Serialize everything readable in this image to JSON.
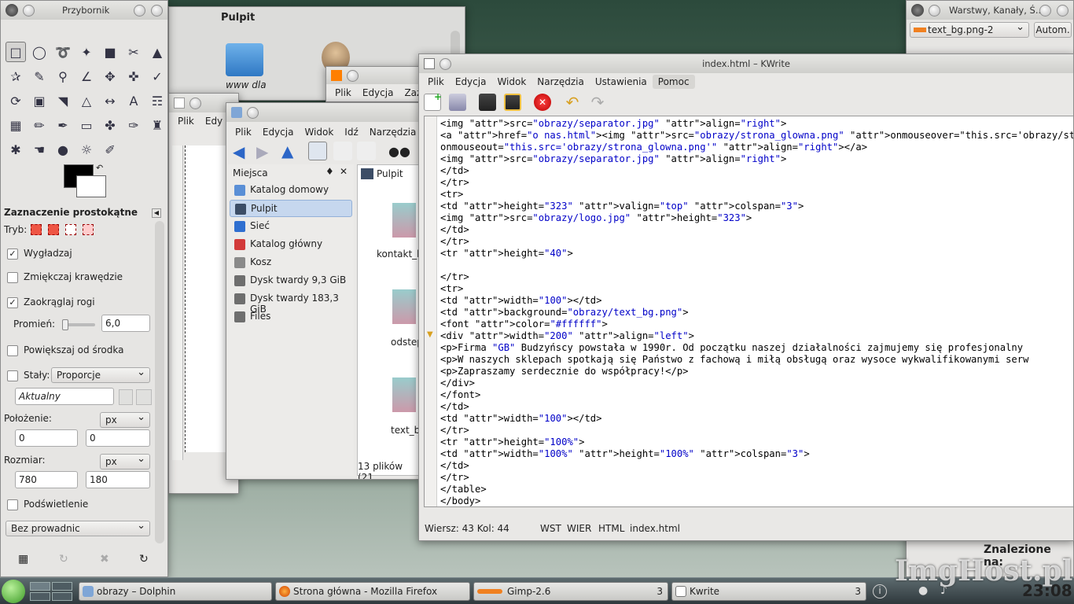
{
  "toolbox": {
    "title": "Przybornik",
    "section_title": "Zaznaczenie prostokątne",
    "mode_label": "Tryb:",
    "antialias_label": "Wygładzaj",
    "feather_label": "Zmiękczaj krawędzie",
    "rounded_label": "Zaokrąglaj rogi",
    "radius_label": "Promień:",
    "radius_value": "6,0",
    "expand_label": "Powiększaj od środka",
    "fixed_label": "Stały:",
    "fixed_value": "Proporcje",
    "current_value": "Aktualny",
    "position_label": "Położenie:",
    "position_unit": "px",
    "pos_x": "0",
    "pos_y": "0",
    "size_label": "Rozmiar:",
    "size_unit": "px",
    "size_w": "780",
    "size_h": "180",
    "highlight_label": "Podświetlenie",
    "guides_value": "Bez prowadnic"
  },
  "desktop": {
    "title": "Pulpit",
    "icon_label": "www dla"
  },
  "firefox_back": {
    "menu": [
      "Plik",
      "Edycja",
      "Zaz"
    ]
  },
  "gimp_back": {
    "menu": [
      "Plik",
      "Edy"
    ]
  },
  "dolphin": {
    "menu": [
      "Plik",
      "Edycja",
      "Widok",
      "Idź",
      "Narzędzia"
    ],
    "places_title": "Miejsca",
    "places": [
      {
        "label": "Katalog domowy",
        "icon": "home-folder-icon",
        "color": "#5a8fd6"
      },
      {
        "label": "Pulpit",
        "icon": "desktop-icon",
        "color": "#3c4d66"
      },
      {
        "label": "Sieć",
        "icon": "network-icon",
        "color": "#2f6fd0"
      },
      {
        "label": "Katalog główny",
        "icon": "root-folder-icon",
        "color": "#d23a3a"
      },
      {
        "label": "Kosz",
        "icon": "trash-icon",
        "color": "#8a8a8a"
      },
      {
        "label": "Dysk twardy 9,3 GiB",
        "icon": "hard-disk-icon",
        "color": "#6e6e6e"
      },
      {
        "label": "Dysk twardy 183,3 GiB",
        "icon": "hard-disk-icon",
        "color": "#6e6e6e"
      },
      {
        "label": "Files",
        "icon": "files-icon",
        "color": "#6e6e6e"
      }
    ],
    "breadcrumb": "Pulpit",
    "files": [
      "kontakt_h",
      "odstep",
      "text_b"
    ],
    "status": "13 plików (21"
  },
  "kwrite": {
    "title": "index.html – KWrite",
    "menu": [
      "Plik",
      "Edycja",
      "Widok",
      "Narzędzia",
      "Ustawienia",
      "Pomoc"
    ],
    "status_pos": "Wiersz: 43 Kol: 44",
    "status_mode1": "WST",
    "status_mode2": "WIER",
    "status_syntax": "HTML",
    "status_file": "index.html",
    "lines": [
      "<img src=\"obrazy/separator.jpg\" align=\"right\">",
      "<a href=\"o nas.html\"><img src=\"obrazy/strona_glowna.png\" onmouseover=\"this.src='obrazy/strona_glowna_",
      "onmouseout=\"this.src='obrazy/strona_glowna.png'\" align=\"right\"></a>",
      "<img src=\"obrazy/separator.jpg\" align=\"right\">",
      "</td>",
      "</tr>",
      "<tr>",
      "<td height=\"323\" valign=\"top\" colspan=\"3\">",
      "<img src=\"obrazy/logo.jpg\" height=\"323\">",
      "</td>",
      "</tr>",
      "<tr height=\"40\">",
      "",
      "</tr>",
      "<tr>",
      "<td width=\"100\"></td>",
      "<td background=\"obrazy/text_bg.png\">",
      "<font color=\"#ffffff\">",
      "<div width=\"200\" align=\"left\">",
      "<p>Firma \"GB\" Budzyńscy powstała w 1990r. Od początku naszej działalności zajmujemy się profesjonalny",
      "<p>W naszych sklepach spotkają się Państwo z fachową i miłą obsługą oraz wysoce wykwalifikowanymi serw",
      "<p>Zapraszamy serdecznie do współpracy!</p>",
      "</div>",
      "</font>",
      "</td>",
      "<td width=\"100\"></td>",
      "</tr>",
      "<tr height=\"100%\">",
      "<td width=\"100%\" height=\"100%\" colspan=\"3\">",
      "</td>",
      "</tr>",
      "</table>",
      "</body>"
    ]
  },
  "layers": {
    "title": "Warstwy, Kanały, Ś...",
    "image_select": "text_bg.png-2",
    "auto_button": "Autom.",
    "found_label": "Znalezione na:"
  },
  "taskbar": {
    "tasks": [
      "obrazy – Dolphin",
      "Strona główna - Mozilla Firefox",
      "Gimp-2.6",
      "Kwrite"
    ],
    "task_counts": [
      "3",
      "3"
    ],
    "clock": "23:08",
    "watermark": "ImgHost.pl"
  }
}
